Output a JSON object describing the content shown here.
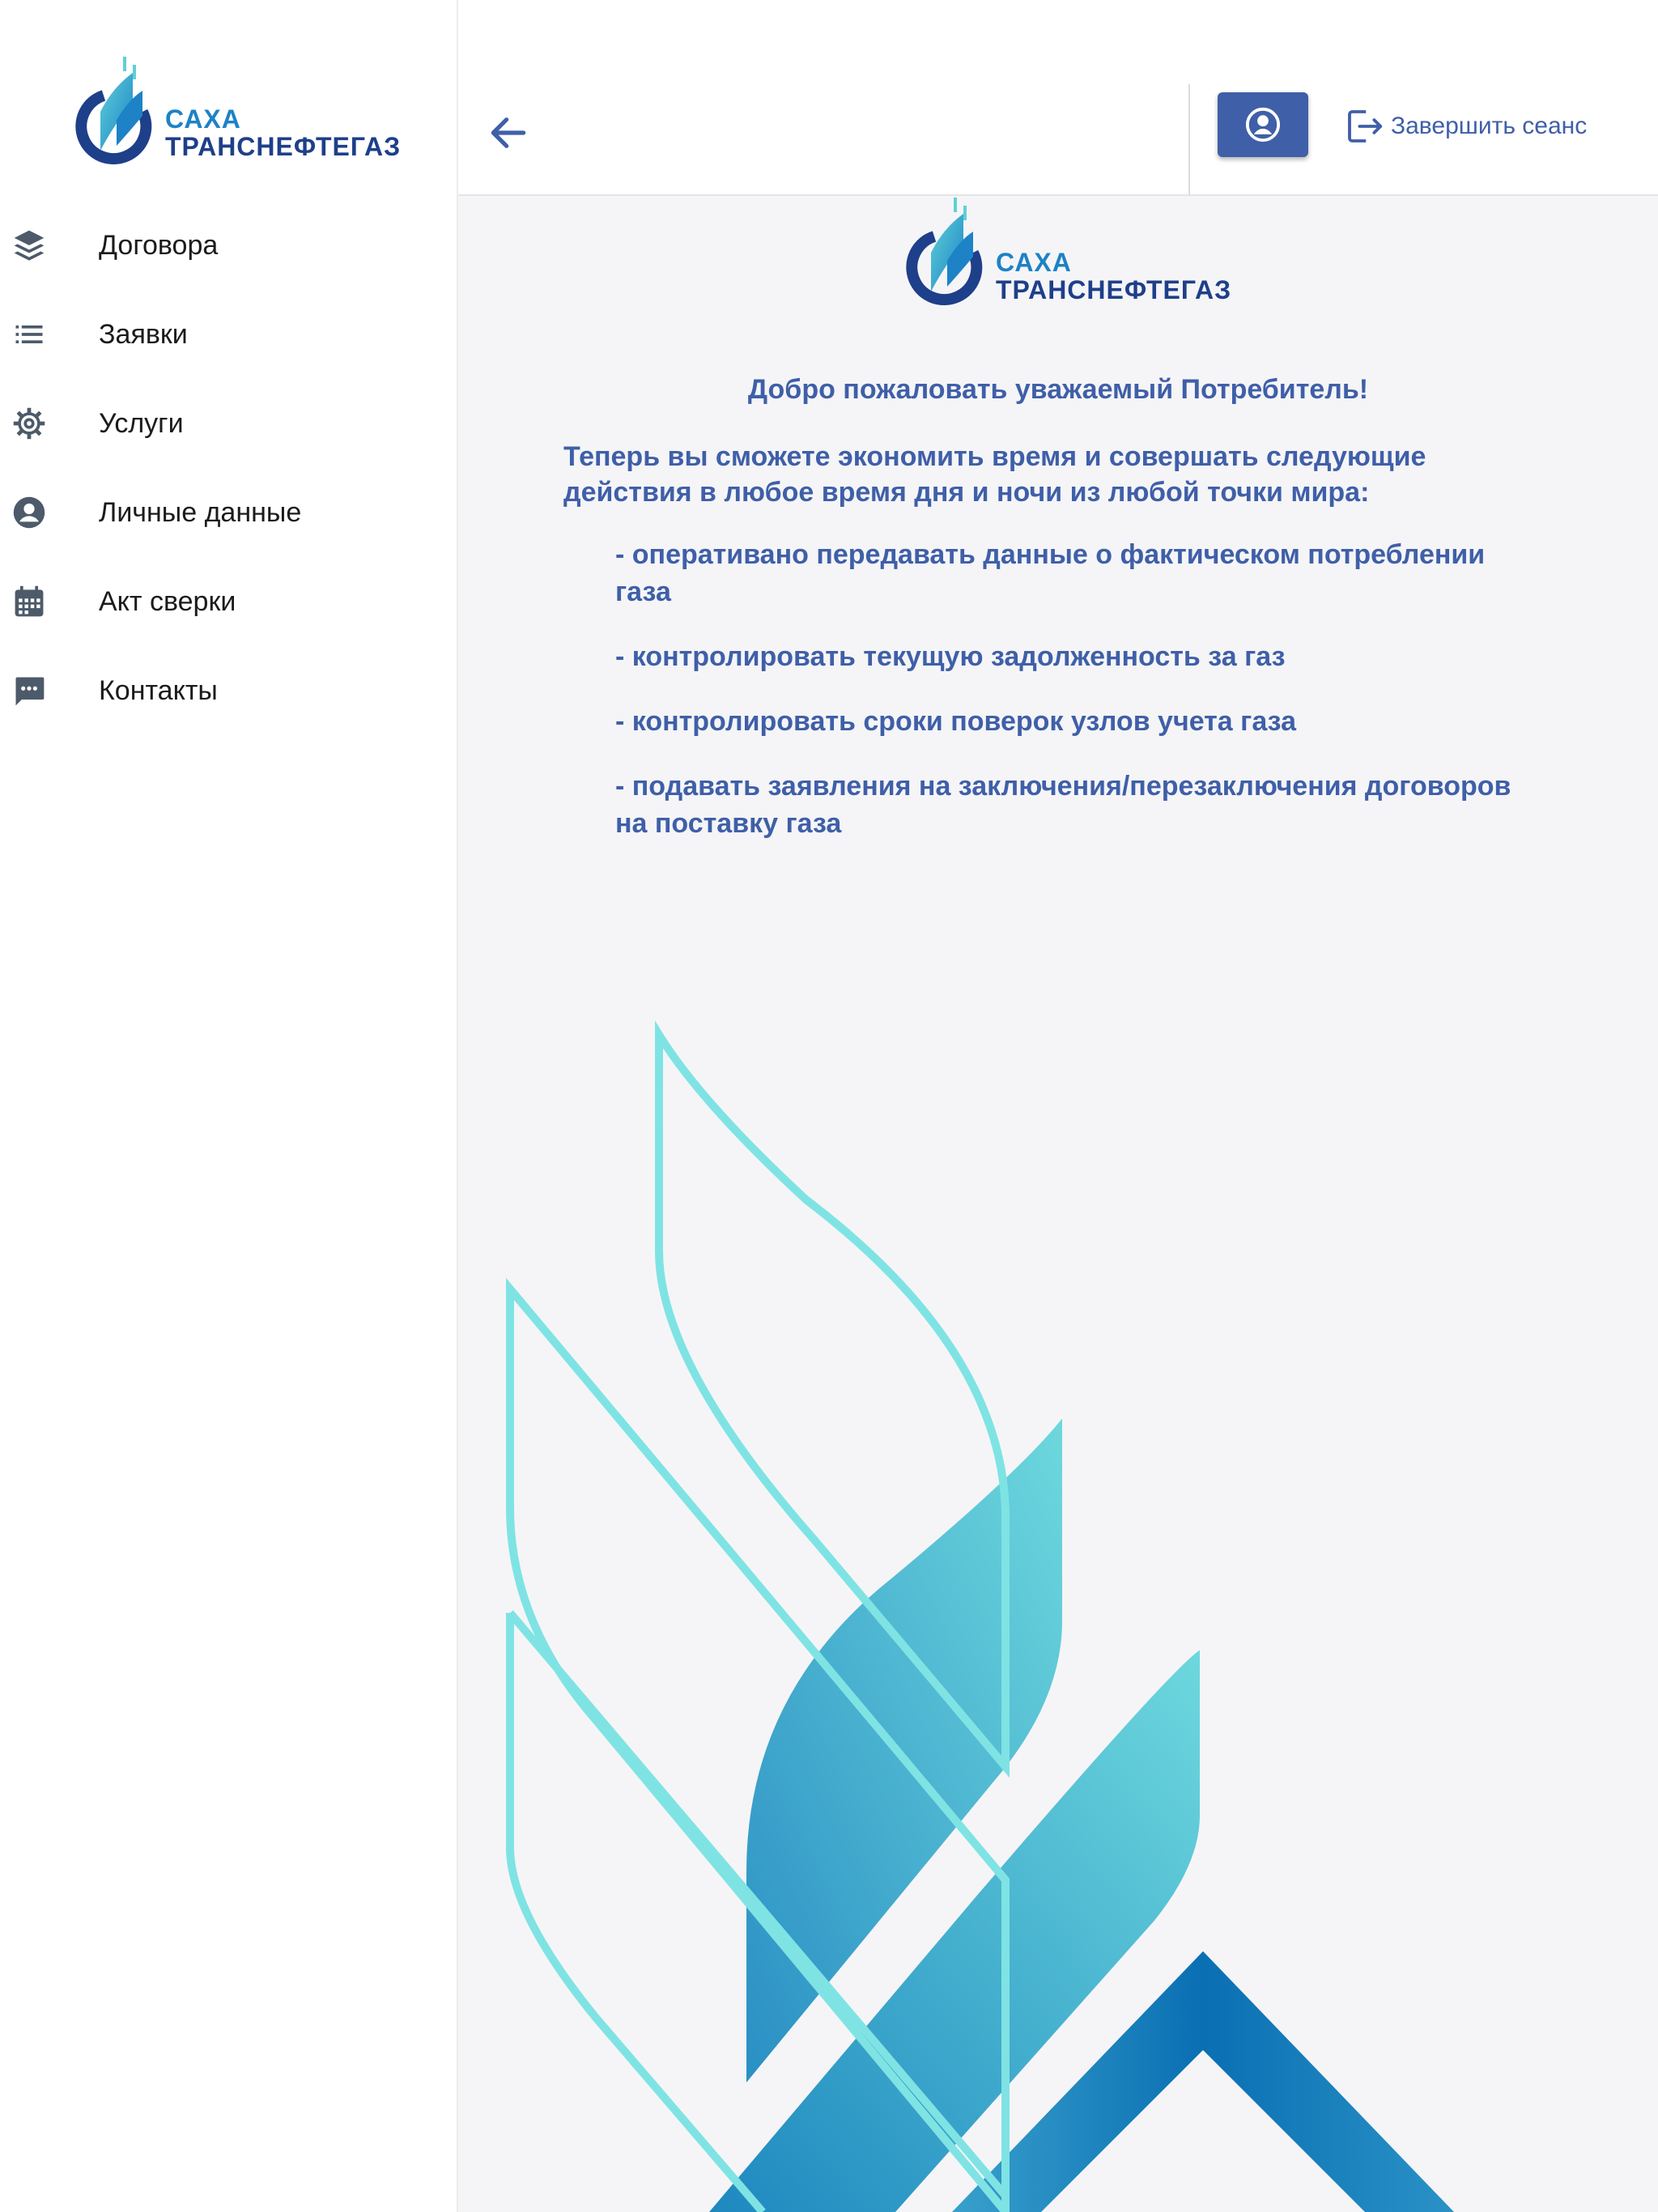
{
  "brand": {
    "line1": "САХА",
    "line2": "ТРАНСНЕФТЕГАЗ"
  },
  "sidebar": {
    "items": [
      {
        "label": "Договора",
        "icon": "layers-icon"
      },
      {
        "label": "Заявки",
        "icon": "list-icon"
      },
      {
        "label": "Услуги",
        "icon": "gear-icon"
      },
      {
        "label": "Личные данные",
        "icon": "user-circle-icon"
      },
      {
        "label": "Акт сверки",
        "icon": "calendar-icon"
      },
      {
        "label": "Контакты",
        "icon": "chat-icon"
      }
    ]
  },
  "header": {
    "back_icon": "arrow-left-icon",
    "profile_icon": "user-circle-icon",
    "logout_label": "Завершить сеанс",
    "logout_icon": "logout-icon"
  },
  "main": {
    "title": "Добро пожаловать уважаемый Потребитель!",
    "intro": "Теперь вы сможете экономить время и совершать следующие действия в любое время дня и ночи из любой точки мира:",
    "features": [
      "- оперативано передавать данные о фактическом потреблении газа",
      "- контролировать текущую задолженность за газ",
      "- контролировать сроки поверок узлов учета газа",
      "- подавать заявления на заключения/перезаключения договоров на поставку газа"
    ]
  },
  "colors": {
    "brand_dark": "#1e3f8a",
    "brand_light": "#1d82c6",
    "accent": "#3f5fa8",
    "decor_outline": "#7fe3e4",
    "decor_fill_light": "#6dd8dd",
    "decor_fill_dark": "#0a6fb3"
  }
}
